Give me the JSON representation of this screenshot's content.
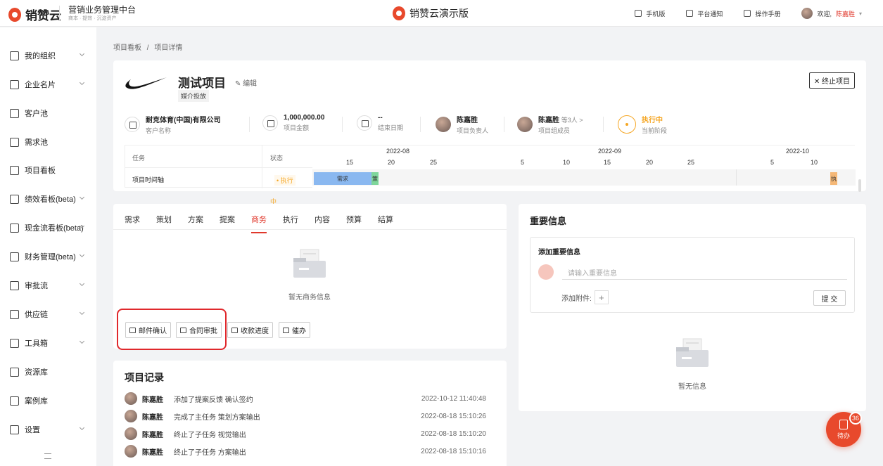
{
  "topbar": {
    "logo_text": "销赞云",
    "system_title": "营销业务管理中台",
    "system_subtitle": "商本 · 提效 · 沉淀资产",
    "center_title": "销赞云演示版",
    "mobile": "手机版",
    "notice": "平台通知",
    "manual": "操作手册",
    "welcome": "欢迎,",
    "username": "陈嘉胜"
  },
  "sidebar": {
    "items": [
      {
        "label": "我的组织",
        "icon": "org-icon"
      },
      {
        "label": "企业名片",
        "icon": "building-icon"
      },
      {
        "label": "客户池",
        "icon": "user-icon"
      },
      {
        "label": "需求池",
        "icon": "doc-icon"
      },
      {
        "label": "项目看板",
        "icon": "board-icon"
      },
      {
        "label": "绩效看板(beta)",
        "icon": "chart-icon"
      },
      {
        "label": "现金流看板(beta)",
        "icon": "cash-icon"
      },
      {
        "label": "财务管理(beta)",
        "icon": "wallet-icon"
      },
      {
        "label": "审批流",
        "icon": "stamp-icon"
      },
      {
        "label": "供应链",
        "icon": "chain-icon"
      },
      {
        "label": "工具箱",
        "icon": "toolbox-icon"
      },
      {
        "label": "资源库",
        "icon": "folder-icon"
      },
      {
        "label": "案例库",
        "icon": "case-icon"
      },
      {
        "label": "设置",
        "icon": "gear-icon"
      }
    ]
  },
  "breadcrumb": {
    "parent": "项目看板",
    "separator": "/",
    "current": "项目详情"
  },
  "project": {
    "title": "测试项目",
    "edit": "编辑",
    "tag": "媒介投放",
    "stop": "终止项目",
    "meta": [
      {
        "value": "耐克体育(中国)有限公司",
        "label": "客户名称"
      },
      {
        "value": "1,000,000.00",
        "label": "项目金额"
      },
      {
        "value": "--",
        "label": "结束日期"
      },
      {
        "value": "陈嘉胜",
        "label": "项目负责人"
      },
      {
        "value": "陈嘉胜",
        "extra": "等3人 >",
        "label": "项目组成员"
      },
      {
        "value": "执行中",
        "label": "当前阶段"
      }
    ]
  },
  "gantt": {
    "col_task": "任务",
    "col_status": "状态",
    "row_task": "项目时间轴",
    "row_status": "执行",
    "row_status_extra": "中",
    "months": [
      "2022-08",
      "2022-09",
      "2022-10"
    ],
    "ticks": [
      "15",
      "20",
      "25",
      "5",
      "10",
      "15",
      "20",
      "25",
      "5",
      "10"
    ],
    "bar_need": "需求",
    "bar_plan": "策",
    "bar_exec": "执"
  },
  "tabs": {
    "items": [
      "需求",
      "策划",
      "方案",
      "提案",
      "商务",
      "执行",
      "内容",
      "预算",
      "结算"
    ],
    "active": "商务"
  },
  "business": {
    "empty": "暂无商务信息",
    "btn_mail": "邮件确认",
    "btn_contract": "合同审批",
    "btn_payment": "收款进度",
    "btn_remind": "催办"
  },
  "records": {
    "title": "项目记录",
    "rows": [
      {
        "name": "陈嘉胜",
        "text": "添加了提案反馈   确认签约",
        "date": "2022-10-12 11:40:48"
      },
      {
        "name": "陈嘉胜",
        "text": "完成了主任务   策划方案输出",
        "date": "2022-08-18 15:10:26"
      },
      {
        "name": "陈嘉胜",
        "text": "终止了子任务   视觉输出",
        "date": "2022-08-18 15:10:20"
      },
      {
        "name": "陈嘉胜",
        "text": "终止了子任务   方案输出",
        "date": "2022-08-18 15:10:16"
      }
    ]
  },
  "important": {
    "title": "重要信息",
    "add_title": "添加重要信息",
    "placeholder": "请输入重要信息",
    "attach": "添加附件:",
    "plus": "+",
    "submit": "提 交",
    "empty": "暂无信息"
  },
  "pending": {
    "label": "待办",
    "count": "36"
  },
  "colors": {
    "accent": "#e0382c",
    "stage": "#f5a623",
    "bar_need": "#8ab8f0",
    "bar_plan": "#7ed69a",
    "bar_exec": "#f5b877"
  }
}
